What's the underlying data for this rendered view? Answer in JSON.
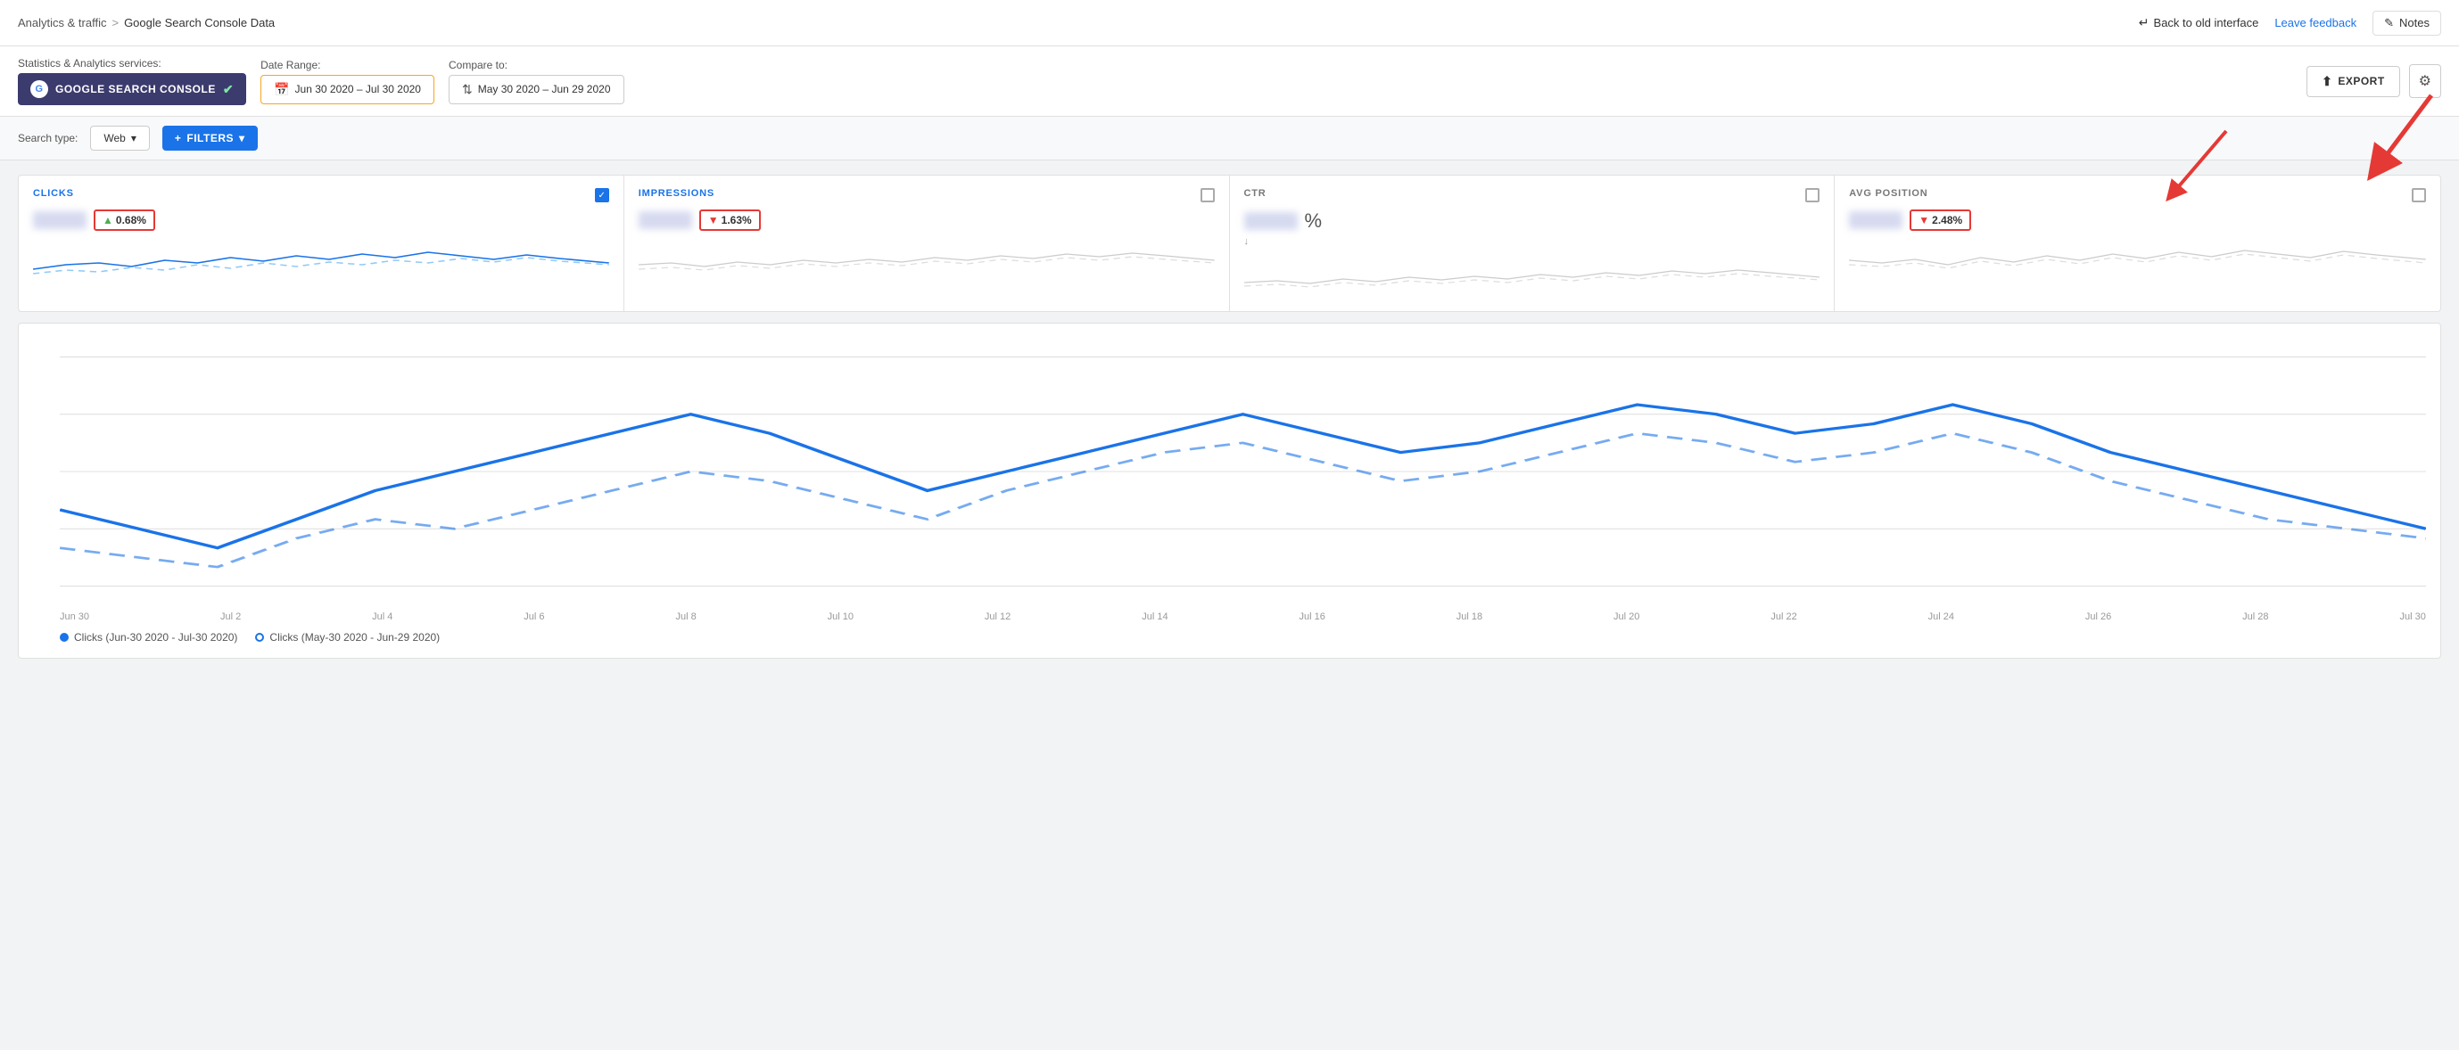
{
  "breadcrumb": {
    "parent": "Analytics & traffic",
    "separator": ">",
    "current": "Google Search Console Data"
  },
  "header": {
    "back_label": "Back to old interface",
    "leave_feedback": "Leave feedback",
    "notes_label": "Notes",
    "notes_icon": "✎"
  },
  "controls": {
    "stats_label": "Statistics & Analytics services:",
    "gsc_label": "GOOGLE SEARCH CONSOLE",
    "date_range_label": "Date Range:",
    "date_value": "Jun 30 2020 – Jul 30 2020",
    "compare_label": "Compare to:",
    "compare_value": "May 30 2020 – Jun 29 2020",
    "export_label": "EXPORT",
    "settings_icon": "⚙"
  },
  "filters": {
    "search_type_label": "Search type:",
    "web_option": "Web",
    "filters_label": "FILTERS",
    "chevron": "▾",
    "plus": "+"
  },
  "metrics": [
    {
      "name": "CLICKS",
      "color": "blue",
      "checked": true,
      "badge": "0.68%",
      "badge_direction": "up",
      "show_badge": true
    },
    {
      "name": "IMPRESSIONS",
      "color": "blue",
      "checked": false,
      "badge": "1.63%",
      "badge_direction": "down",
      "show_badge": true
    },
    {
      "name": "CTR",
      "color": "gray",
      "checked": false,
      "value": "%",
      "sub": "↓",
      "show_badge": false
    },
    {
      "name": "AVG POSITION",
      "color": "gray",
      "checked": false,
      "badge": "2.48%",
      "badge_direction": "down",
      "show_badge": true
    }
  ],
  "chart": {
    "x_labels": [
      "Jun 30",
      "Jul 2",
      "Jul 4",
      "Jul 6",
      "Jul 8",
      "Jul 10",
      "Jul 12",
      "Jul 14",
      "Jul 16",
      "Jul 18",
      "Jul 20",
      "Jul 22",
      "Jul 24",
      "Jul 26",
      "Jul 28",
      "Jul 30"
    ],
    "y_labels": [
      "",
      "",
      ""
    ],
    "legend": [
      {
        "type": "solid",
        "label": "Clicks (Jun-30 2020 - Jul-30 2020)"
      },
      {
        "type": "dashed",
        "label": "Clicks (May-30 2020 - Jun-29 2020)"
      }
    ]
  }
}
